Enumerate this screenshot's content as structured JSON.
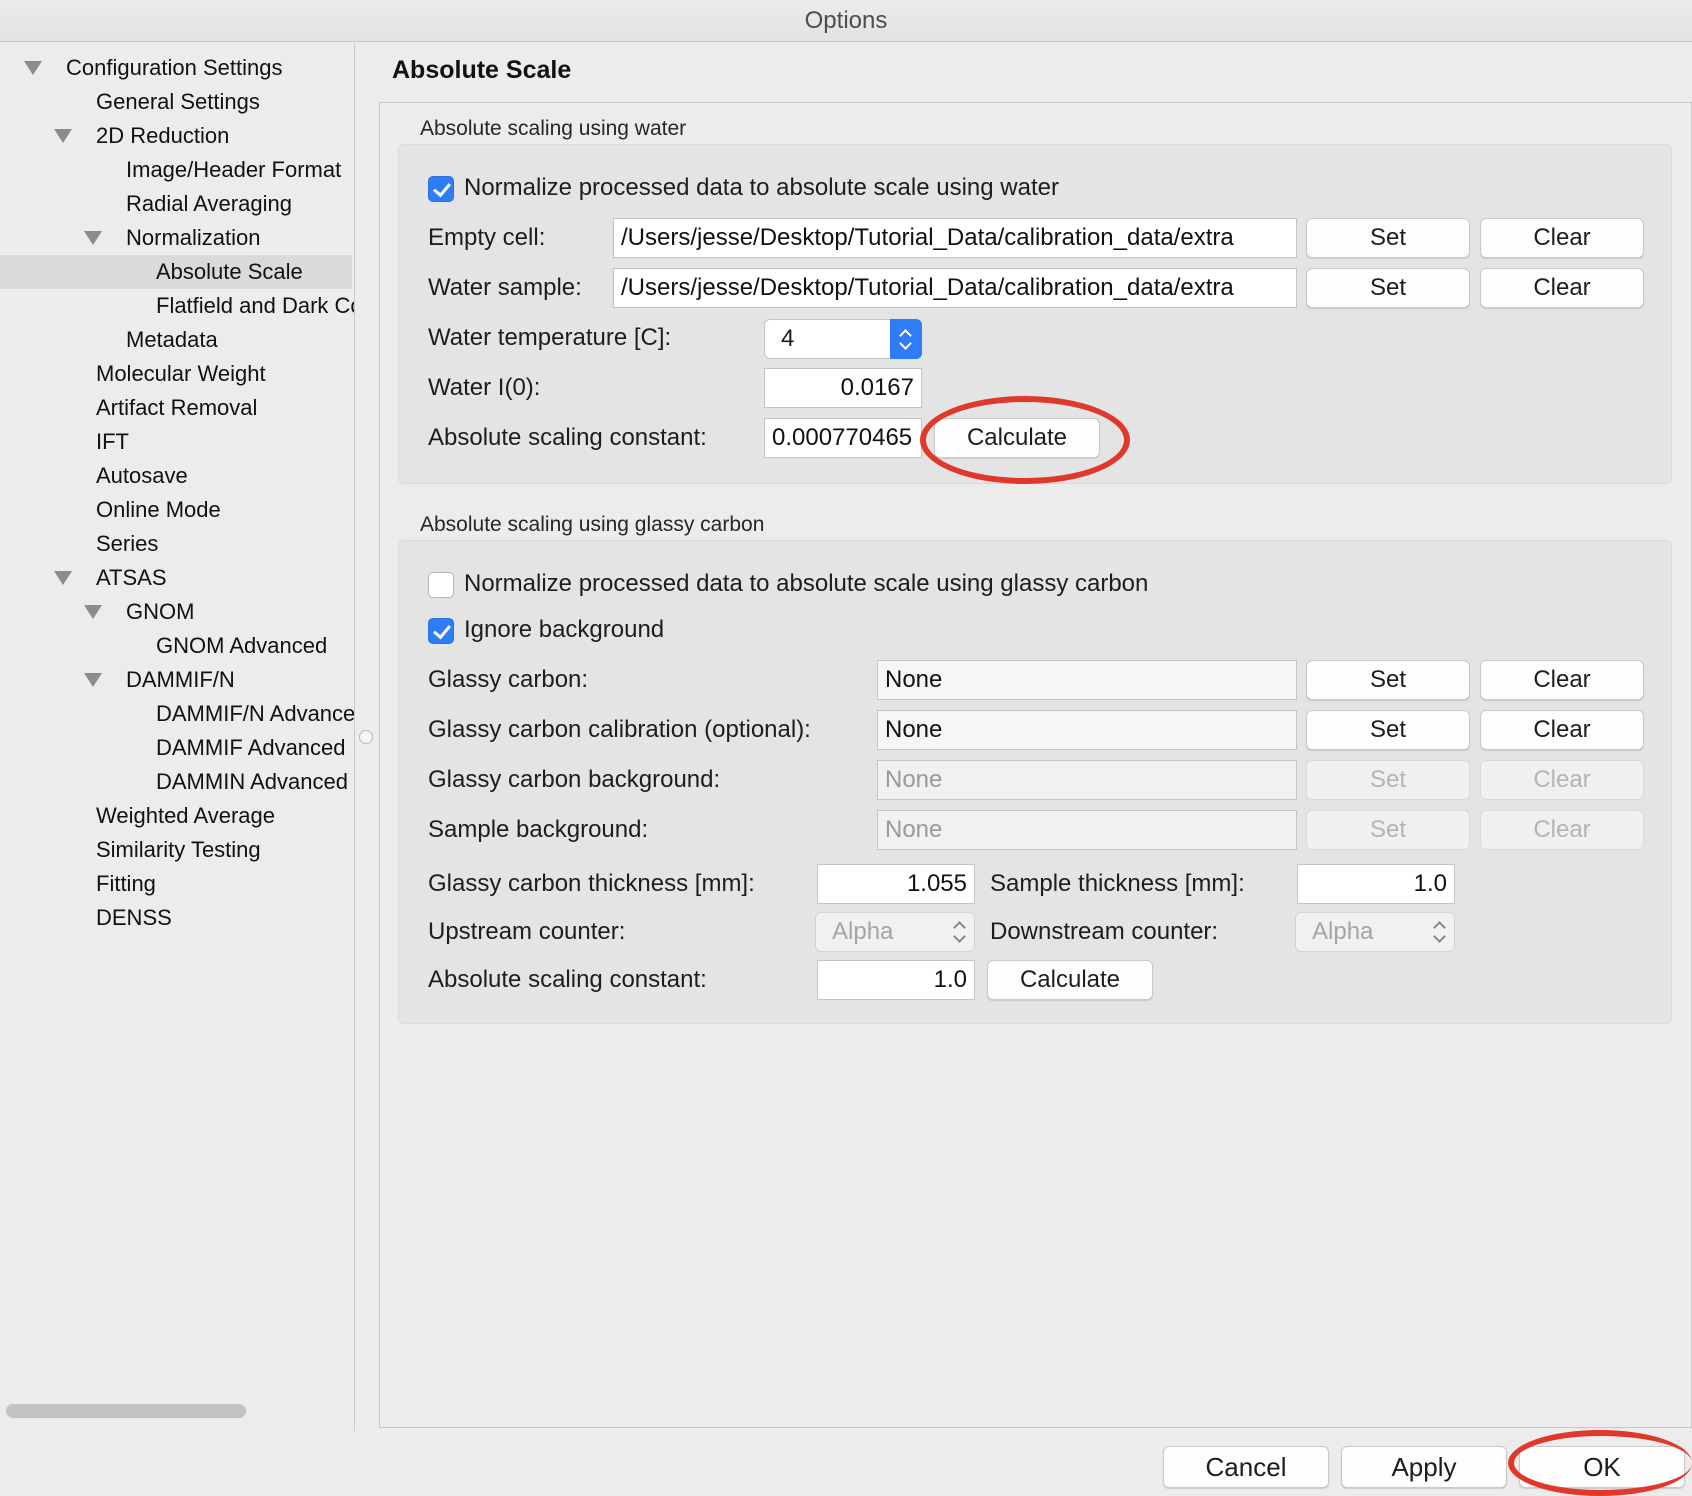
{
  "window": {
    "title": "Options"
  },
  "sidebar": {
    "items": [
      {
        "label": "Configuration Settings",
        "expanded": true
      },
      {
        "label": "General Settings"
      },
      {
        "label": "2D Reduction",
        "expanded": true
      },
      {
        "label": "Image/Header Format"
      },
      {
        "label": "Radial Averaging"
      },
      {
        "label": "Normalization",
        "expanded": true
      },
      {
        "label": "Absolute Scale",
        "selected": true
      },
      {
        "label": "Flatfield and Dark Correction"
      },
      {
        "label": "Metadata"
      },
      {
        "label": "Molecular Weight"
      },
      {
        "label": "Artifact Removal"
      },
      {
        "label": "IFT"
      },
      {
        "label": "Autosave"
      },
      {
        "label": "Online Mode"
      },
      {
        "label": "Series"
      },
      {
        "label": "ATSAS",
        "expanded": true
      },
      {
        "label": "GNOM",
        "expanded": true
      },
      {
        "label": "GNOM Advanced"
      },
      {
        "label": "DAMMIF/N",
        "expanded": true
      },
      {
        "label": "DAMMIF/N Advanced"
      },
      {
        "label": "DAMMIF Advanced"
      },
      {
        "label": "DAMMIN Advanced"
      },
      {
        "label": "Weighted Average"
      },
      {
        "label": "Similarity Testing"
      },
      {
        "label": "Fitting"
      },
      {
        "label": "DENSS"
      }
    ]
  },
  "main": {
    "title": "Absolute Scale",
    "water": {
      "group_title": "Absolute scaling using water",
      "normalize_label": "Normalize processed data to absolute scale using water",
      "normalize_checked": true,
      "empty_cell_label": "Empty cell:",
      "empty_cell_value": "/Users/jesse/Desktop/Tutorial_Data/calibration_data/extra",
      "water_sample_label": "Water sample:",
      "water_sample_value": "/Users/jesse/Desktop/Tutorial_Data/calibration_data/extra",
      "temperature_label": "Water temperature [C]:",
      "temperature_value": "4",
      "i0_label": "Water I(0):",
      "i0_value": "0.0167",
      "constant_label": "Absolute scaling constant:",
      "constant_value": "0.000770465",
      "set_label": "Set",
      "clear_label": "Clear",
      "calculate_label": "Calculate"
    },
    "glassy": {
      "group_title": "Absolute scaling using glassy carbon",
      "normalize_label": "Normalize processed data to absolute scale using glassy carbon",
      "normalize_checked": false,
      "ignore_bg_label": "Ignore background",
      "ignore_bg_checked": true,
      "gc_label": "Glassy carbon:",
      "gc_value": "None",
      "gc_cal_label": "Glassy carbon calibration (optional):",
      "gc_cal_value": "None",
      "gc_bg_label": "Glassy carbon background:",
      "gc_bg_value": "None",
      "sample_bg_label": "Sample background:",
      "sample_bg_value": "None",
      "gc_thickness_label": "Glassy carbon thickness [mm]:",
      "gc_thickness_value": "1.055",
      "sample_thickness_label": "Sample thickness [mm]:",
      "sample_thickness_value": "1.0",
      "upstream_label": "Upstream counter:",
      "upstream_value": "Alpha",
      "downstream_label": "Downstream counter:",
      "downstream_value": "Alpha",
      "constant_label": "Absolute scaling constant:",
      "constant_value": "1.0",
      "set_label": "Set",
      "clear_label": "Clear",
      "calculate_label": "Calculate"
    }
  },
  "footer": {
    "cancel_label": "Cancel",
    "apply_label": "Apply",
    "ok_label": "OK"
  },
  "colors": {
    "accent": "#2f7df6",
    "annotation": "#e0392b",
    "selected_row": "#dadada"
  }
}
